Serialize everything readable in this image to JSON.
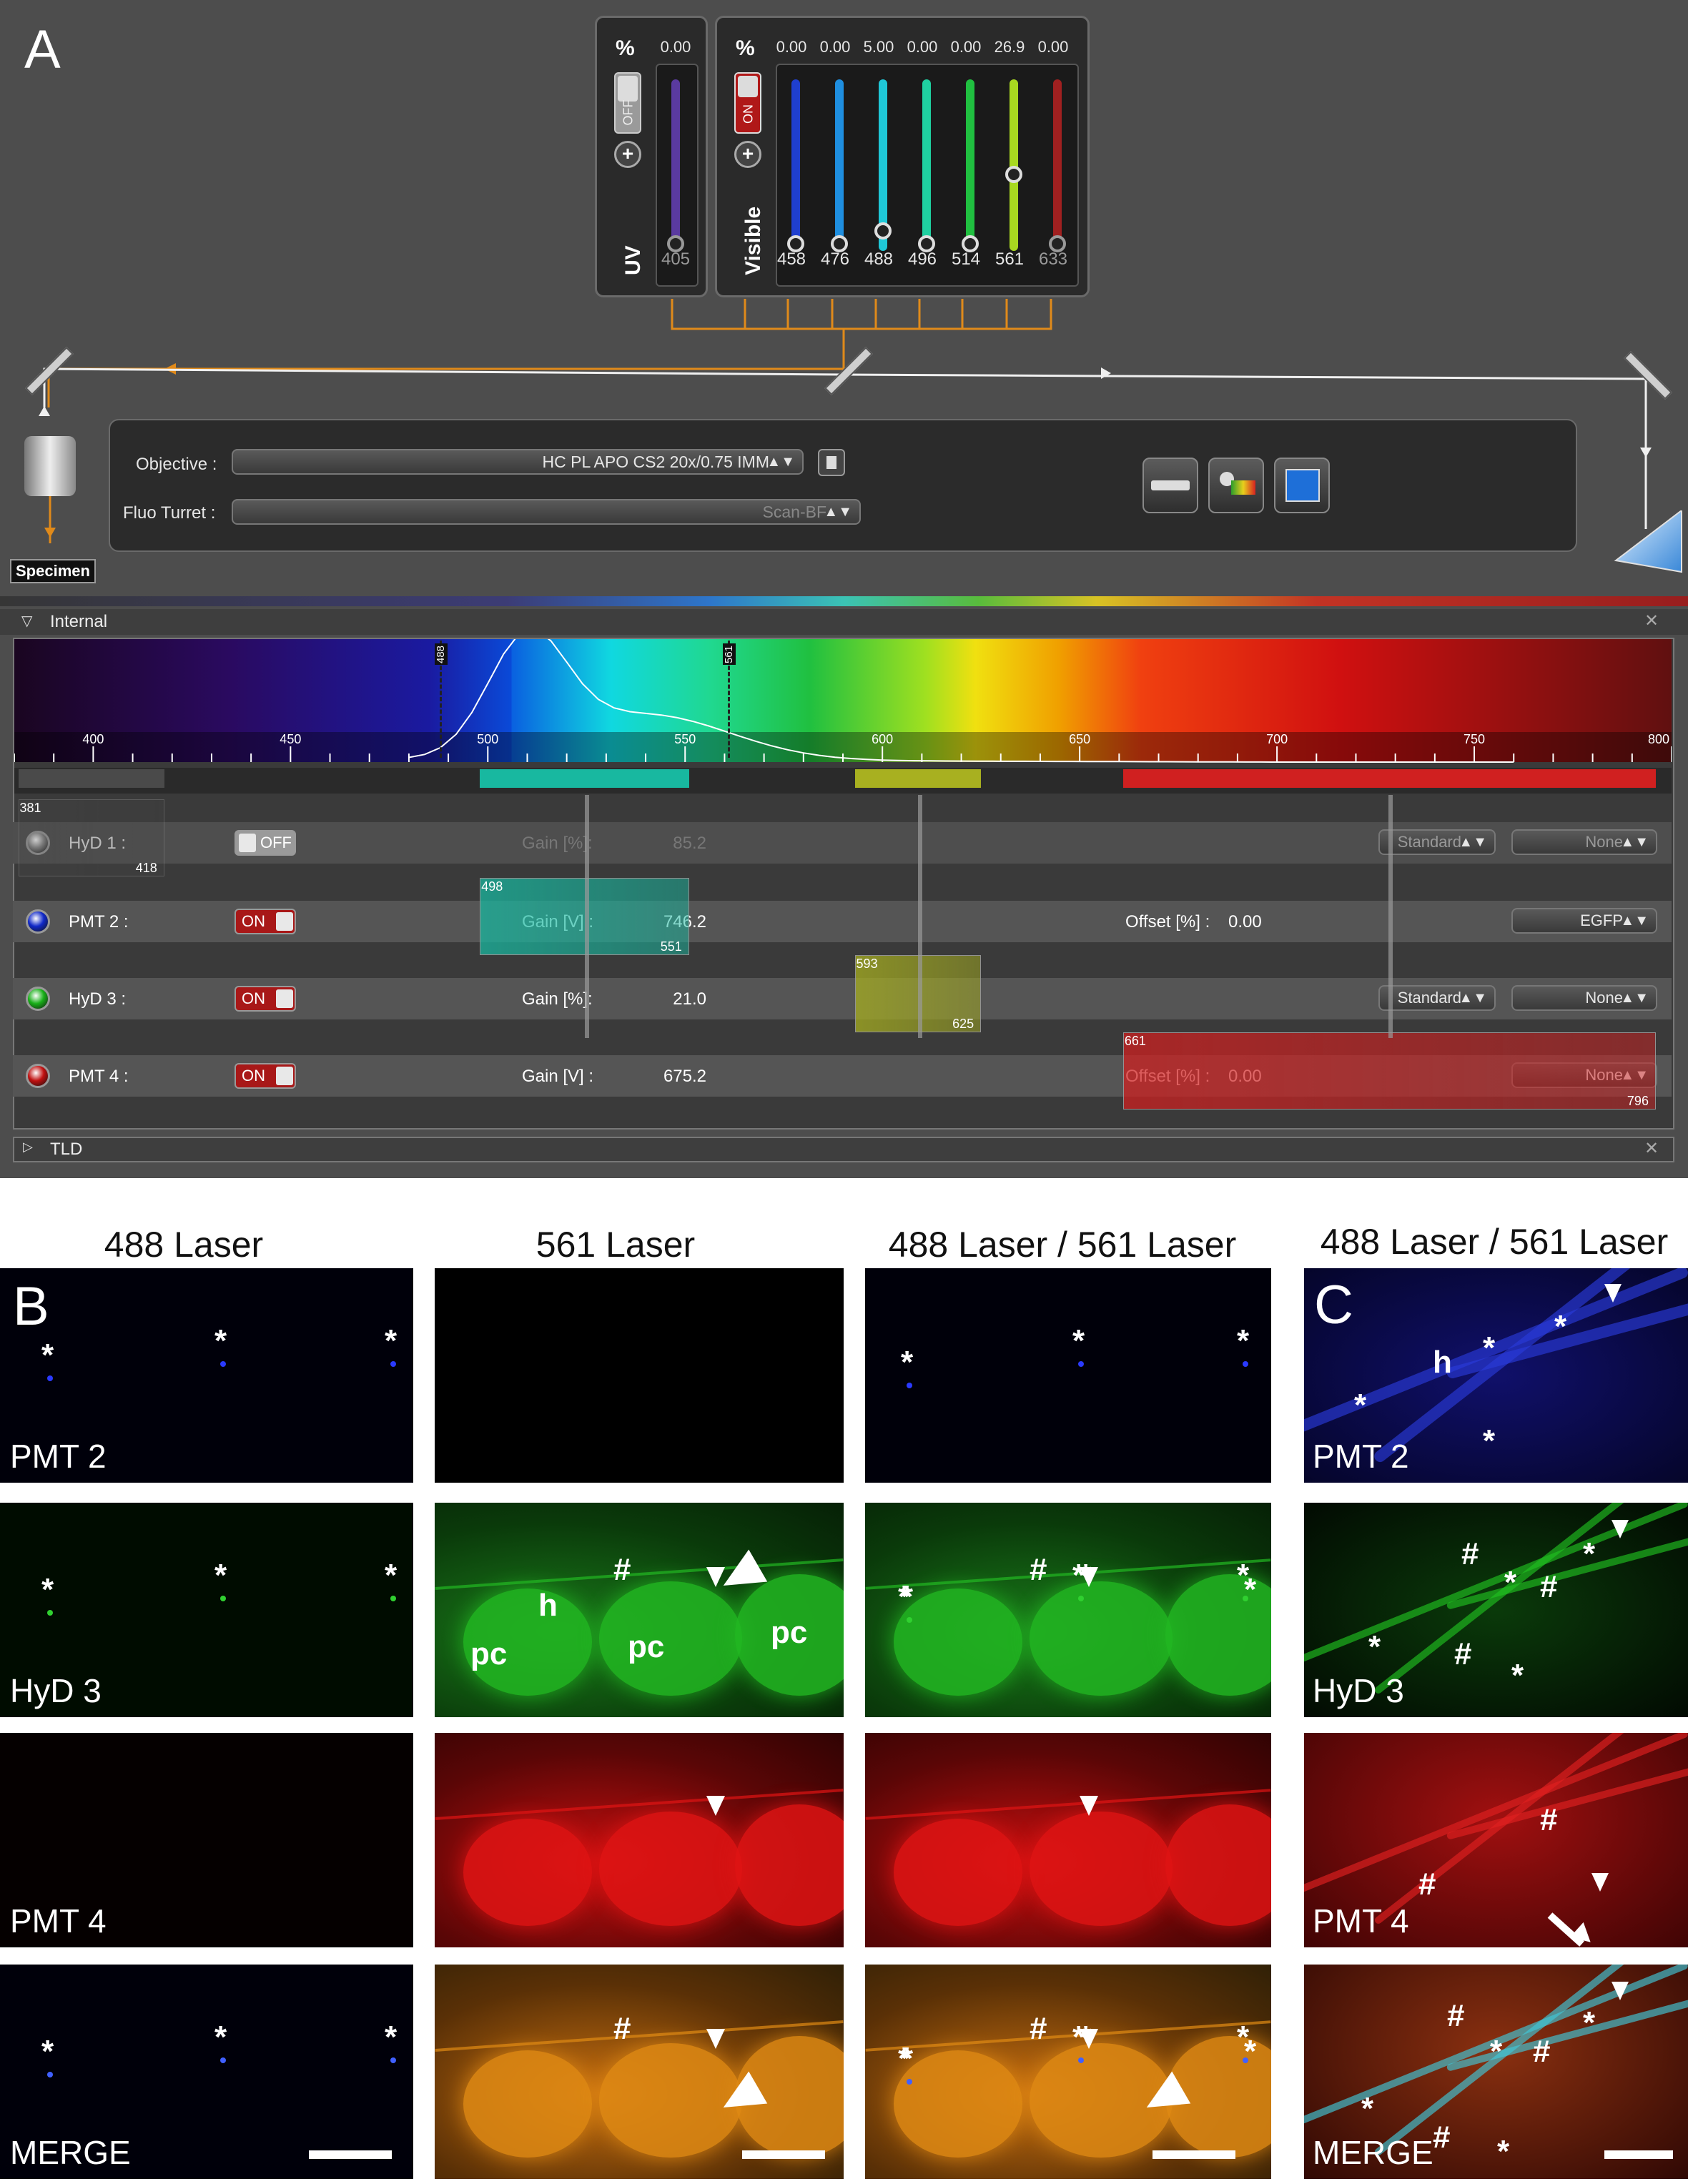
{
  "panels": {
    "a": "A",
    "b": "B",
    "c": "C"
  },
  "lasers": {
    "uv": {
      "title": "UV",
      "percent_symbol": "%",
      "state": "OFF",
      "lines": [
        {
          "wavelength": "405",
          "value": "0.00",
          "level": 0.0,
          "color": "#5a3aa0"
        }
      ]
    },
    "visible": {
      "title": "Visible",
      "percent_symbol": "%",
      "state": "ON",
      "lines": [
        {
          "wavelength": "458",
          "value": "0.00",
          "level": 0.0,
          "color": "#1f3fcf"
        },
        {
          "wavelength": "476",
          "value": "0.00",
          "level": 0.0,
          "color": "#1f8fe0"
        },
        {
          "wavelength": "488",
          "value": "5.00",
          "level": 0.05,
          "color": "#1fc8d8"
        },
        {
          "wavelength": "496",
          "value": "0.00",
          "level": 0.0,
          "color": "#1fd0a0"
        },
        {
          "wavelength": "514",
          "value": "0.00",
          "level": 0.0,
          "color": "#20c040"
        },
        {
          "wavelength": "561",
          "value": "26.9",
          "level": 0.269,
          "color": "#a8d820"
        },
        {
          "wavelength": "633",
          "value": "0.00",
          "level": 0.0,
          "color": "#a02020"
        }
      ]
    },
    "plus_icon": "plus-icon"
  },
  "microscope": {
    "objective_label": "Objective :",
    "objective_value": "HC PL APO CS2   20x/0.75 IMM",
    "fluo_label": "Fluo Turret :",
    "fluo_value": "Scan-BF",
    "specimen_label": "Specimen",
    "tool_icons": [
      "stage-icon",
      "detector-settings-icon",
      "sequence-icon"
    ]
  },
  "spectrum": {
    "section_label": "Internal",
    "tld_label": "TLD",
    "axis_ticks": [
      "400",
      "450",
      "500",
      "550",
      "600",
      "650",
      "700",
      "750",
      "800"
    ],
    "axis_range": [
      380,
      800
    ],
    "laser_markers": [
      "488",
      "561"
    ],
    "emission_curve": "EGFP"
  },
  "detectors": [
    {
      "name": "HyD 1 :",
      "led_color": "#888888",
      "state": "OFF",
      "gain_label": "Gain [%]:",
      "gain_value": "85.2",
      "offset_label": "",
      "offset_value": "",
      "mode": "Standard",
      "dye": "None",
      "band_from": "381",
      "band_to": "418"
    },
    {
      "name": "PMT 2 :",
      "led_color": "#1028c8",
      "state": "ON",
      "gain_label": "Gain [V] :",
      "gain_value": "746.2",
      "offset_label": "Offset [%] :",
      "offset_value": "0.00",
      "mode": "",
      "dye": "EGFP",
      "band_from": "498",
      "band_to": "551"
    },
    {
      "name": "HyD 3 :",
      "led_color": "#18b018",
      "state": "ON",
      "gain_label": "Gain [%]:",
      "gain_value": "21.0",
      "offset_label": "",
      "offset_value": "",
      "mode": "Standard",
      "dye": "None",
      "band_from": "593",
      "band_to": "625"
    },
    {
      "name": "PMT 4 :",
      "led_color": "#c01010",
      "state": "ON",
      "gain_label": "Gain [V] :",
      "gain_value": "675.2",
      "offset_label": "Offset [%] :",
      "offset_value": "0.00",
      "mode": "",
      "dye": "None",
      "band_from": "661",
      "band_to": "796"
    }
  ],
  "micrographs": {
    "columns": [
      "488 Laser",
      "561 Laser",
      "488 Laser / 561 Laser",
      "488 Laser / 561 Laser"
    ],
    "rows": [
      "PMT 2",
      "HyD 3",
      "PMT 4",
      "MERGE"
    ],
    "markers": {
      "asterisk": "*",
      "hash": "#",
      "h": "h",
      "pc": "pc"
    }
  }
}
